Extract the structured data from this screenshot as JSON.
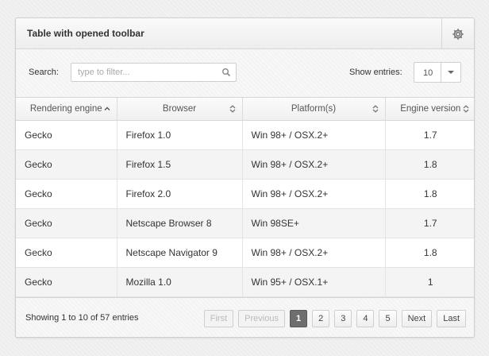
{
  "widget": {
    "title": "Table with opened toolbar"
  },
  "toolbar": {
    "search_label": "Search:",
    "search_placeholder": "type to filter...",
    "entries_label": "Show entries:",
    "entries_value": "10"
  },
  "table": {
    "columns": [
      "Rendering engine",
      "Browser",
      "Platform(s)",
      "Engine version"
    ],
    "rows": [
      [
        "Gecko",
        "Firefox 1.0",
        "Win 98+ / OSX.2+",
        "1.7"
      ],
      [
        "Gecko",
        "Firefox 1.5",
        "Win 98+ / OSX.2+",
        "1.8"
      ],
      [
        "Gecko",
        "Firefox 2.0",
        "Win 98+ / OSX.2+",
        "1.8"
      ],
      [
        "Gecko",
        "Netscape Browser 8",
        "Win 98SE+",
        "1.7"
      ],
      [
        "Gecko",
        "Netscape Navigator 9",
        "Win 98+ / OSX.2+",
        "1.8"
      ],
      [
        "Gecko",
        "Mozilla 1.0",
        "Win 95+ / OSX.1+",
        "1"
      ]
    ]
  },
  "footer": {
    "info": "Showing 1 to 10 of 57 entries",
    "pager": {
      "first": "First",
      "previous": "Previous",
      "pages": [
        "1",
        "2",
        "3",
        "4",
        "5"
      ],
      "next": "Next",
      "last": "Last"
    }
  },
  "icons": {
    "settings": "gear-icon",
    "search": "search-icon",
    "dropdown": "chevron-down-icon",
    "sort_asc": "sort-asc-icon",
    "sort_both": "sort-both-icon"
  },
  "colors": {
    "active_page": "#6e6e6e",
    "border": "#cfcfcf"
  }
}
